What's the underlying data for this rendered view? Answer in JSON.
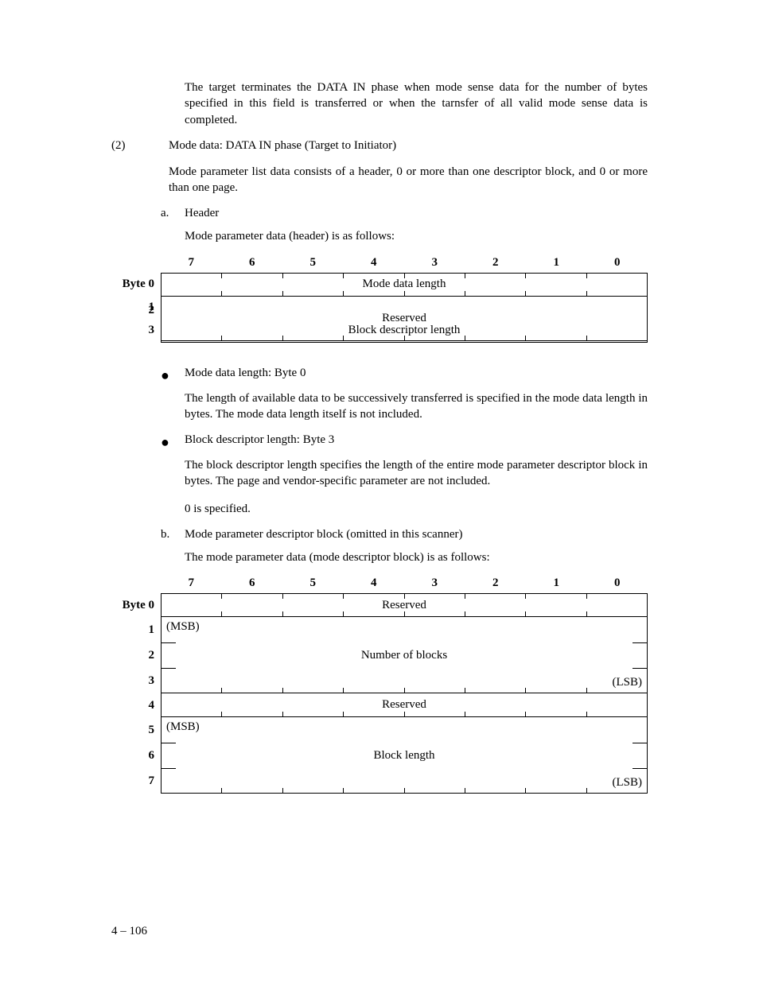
{
  "intro": "The target terminates the DATA IN phase when mode sense data for the number of bytes specified in this field is transferred or when the tarnsfer of all valid mode sense data is completed.",
  "sec2_num": "(2)",
  "sec2_title": "Mode data:  DATA IN phase (Target to Initiator)",
  "sec2_para": "Mode parameter list data consists of a header, 0 or more than one descriptor block, and 0 or more than one page.",
  "sub_a_num": "a.",
  "sub_a_title": "Header",
  "sub_a_para": "Mode parameter data (header) is as follows:",
  "bits": [
    "7",
    "6",
    "5",
    "4",
    "3",
    "2",
    "1",
    "0"
  ],
  "t1_byte0": "Byte 0",
  "t1_byte1": "1",
  "t1_byte2": "2",
  "t1_byte3": "3",
  "t1_r0": "Mode data length",
  "t1_r1": "Reserved",
  "t1_r3": "Block descriptor length",
  "bullet1_title": "Mode data length:  Byte 0",
  "bullet1_para": "The length of available data to be successively transferred is specified in the mode data length in bytes.  The mode data length itself is not included.",
  "bullet2_title": "Block descriptor length:  Byte 3",
  "bullet2_para": "The block descriptor length specifies the length of the entire mode parameter descriptor block in bytes.  The page and vendor-specific parameter are not included.",
  "bullet2_para2": "0 is specified.",
  "sub_b_num": "b.",
  "sub_b_title": "Mode parameter descriptor block (omitted in this scanner)",
  "sub_b_para": "The mode parameter data (mode descriptor block) is as follows:",
  "t2_byte0": "Byte 0",
  "t2_byte1": "1",
  "t2_byte2": "2",
  "t2_byte3": "3",
  "t2_byte4": "4",
  "t2_byte5": "5",
  "t2_byte6": "6",
  "t2_byte7": "7",
  "t2_r0": "Reserved",
  "t2_r2": "Number of blocks",
  "t2_r4": "Reserved",
  "t2_r6": "Block length",
  "msb": "(MSB)",
  "lsb": "(LSB)",
  "page_num": "4 – 106"
}
